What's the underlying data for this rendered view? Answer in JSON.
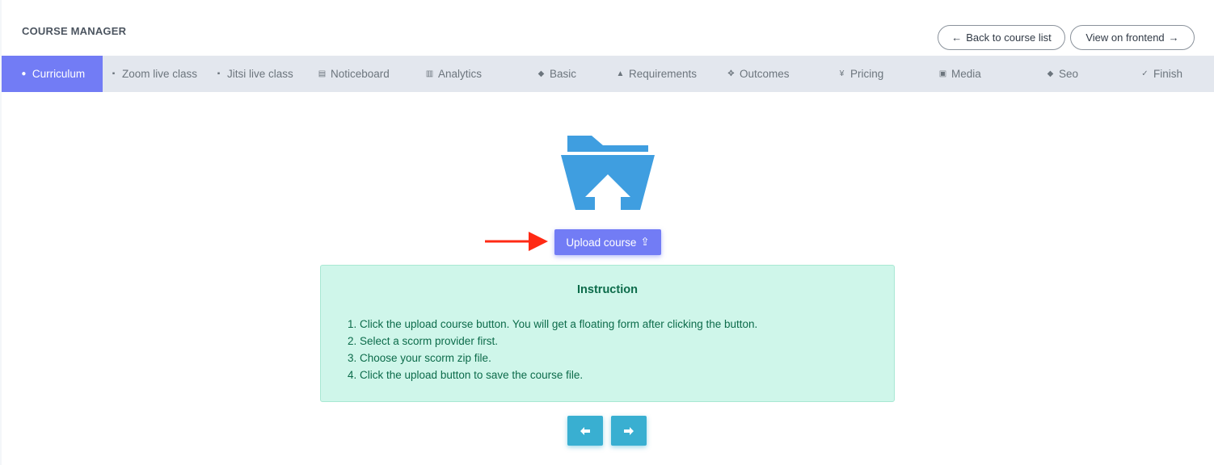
{
  "header": {
    "title": "COURSE MANAGER",
    "back_label": "Back to course list",
    "back_icon": "←",
    "frontend_label": "View on frontend",
    "frontend_icon": "→"
  },
  "tabs": [
    {
      "label": "Curriculum",
      "icon": "user-circle-icon",
      "glyph": "●",
      "active": true
    },
    {
      "label": "Zoom live class",
      "icon": "video-icon",
      "glyph": "▪",
      "active": false
    },
    {
      "label": "Jitsi live class",
      "icon": "video-icon",
      "glyph": "▪",
      "active": false
    },
    {
      "label": "Noticeboard",
      "icon": "clipboard-icon",
      "glyph": "▤",
      "active": false
    },
    {
      "label": "Analytics",
      "icon": "chart-icon",
      "glyph": "▥",
      "active": false
    },
    {
      "label": "Basic",
      "icon": "leaf-icon",
      "glyph": "◆",
      "active": false
    },
    {
      "label": "Requirements",
      "icon": "bell-icon",
      "glyph": "▲",
      "active": false
    },
    {
      "label": "Outcomes",
      "icon": "move-icon",
      "glyph": "✥",
      "active": false
    },
    {
      "label": "Pricing",
      "icon": "yen-icon",
      "glyph": "¥",
      "active": false
    },
    {
      "label": "Media",
      "icon": "media-icon",
      "glyph": "▣",
      "active": false
    },
    {
      "label": "Seo",
      "icon": "tag-icon",
      "glyph": "◆",
      "active": false
    },
    {
      "label": "Finish",
      "icon": "check-circle-icon",
      "glyph": "✓",
      "active": false
    }
  ],
  "upload": {
    "label": "Upload course",
    "icon": "⇪"
  },
  "instruction": {
    "title": "Instruction",
    "steps": [
      "1. Click the upload course button. You will get a floating form after clicking the button.",
      "2. Select a scorm provider first.",
      "3. Choose your scorm zip file.",
      "4. Click the upload button to save the course file."
    ]
  },
  "nav": {
    "prev_icon": "🡐",
    "next_icon": "🡒"
  },
  "colors": {
    "primary": "#727cf5",
    "info": "#39afd1",
    "folder": "#3f9ee0",
    "success_bg": "#cff6ea",
    "success_text": "#0c6b4a",
    "annotation_arrow": "#ff2a14"
  }
}
